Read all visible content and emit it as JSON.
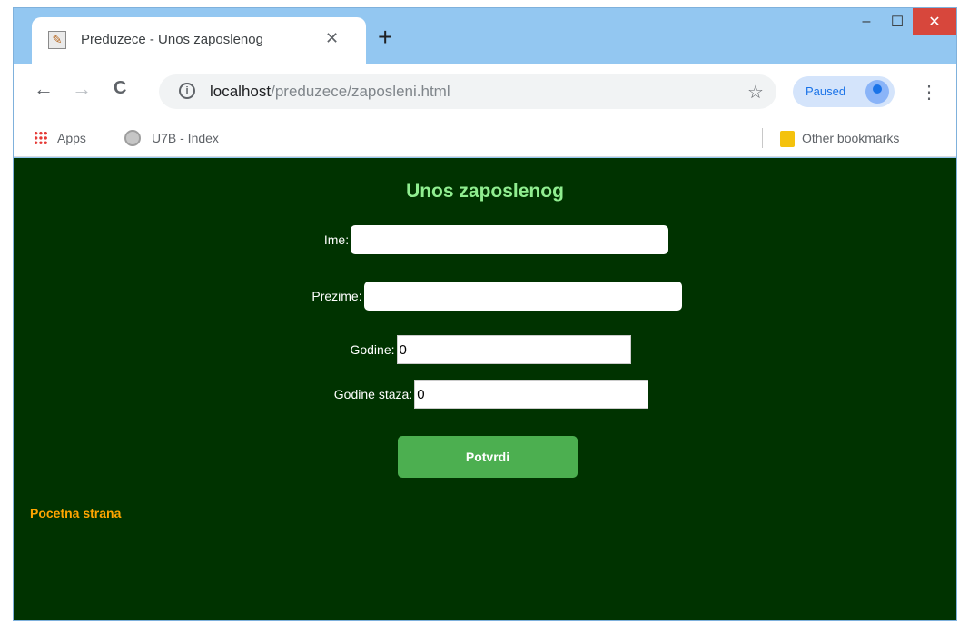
{
  "browser": {
    "tab": {
      "title": "Preduzece - Unos zaposlenog",
      "close_glyph": "✕",
      "favicon": "page-favicon-icon"
    },
    "new_tab_glyph": "+",
    "window_controls": {
      "minimize": "–",
      "maximize": "☐",
      "close": "✕"
    },
    "nav": {
      "back": "←",
      "forward": "→",
      "reload": "C"
    },
    "address": {
      "host": "localhost",
      "path": "/preduzece/zaposleni.html"
    },
    "star_glyph": "☆",
    "profile": {
      "label": "Paused"
    },
    "menu_glyph": "⋮",
    "bookmarks": {
      "apps": "Apps",
      "index": "U7B - Index",
      "other": "Other bookmarks"
    }
  },
  "page": {
    "heading": "Unos zaposlenog",
    "form": {
      "ime_label": "Ime:",
      "ime_value": "",
      "prezime_label": "Prezime:",
      "prezime_value": "",
      "godine_label": "Godine:",
      "godine_value": "0",
      "godine_staza_label": "Godine staza:",
      "godine_staza_value": "0",
      "submit_label": "Potvrdi"
    },
    "home_link": "Pocetna strana"
  },
  "colors": {
    "page_background": "#003300",
    "heading": "#90ee90",
    "submit_button": "#4caf50",
    "home_link": "#ffa500",
    "window_frame": "#93c7f1"
  }
}
